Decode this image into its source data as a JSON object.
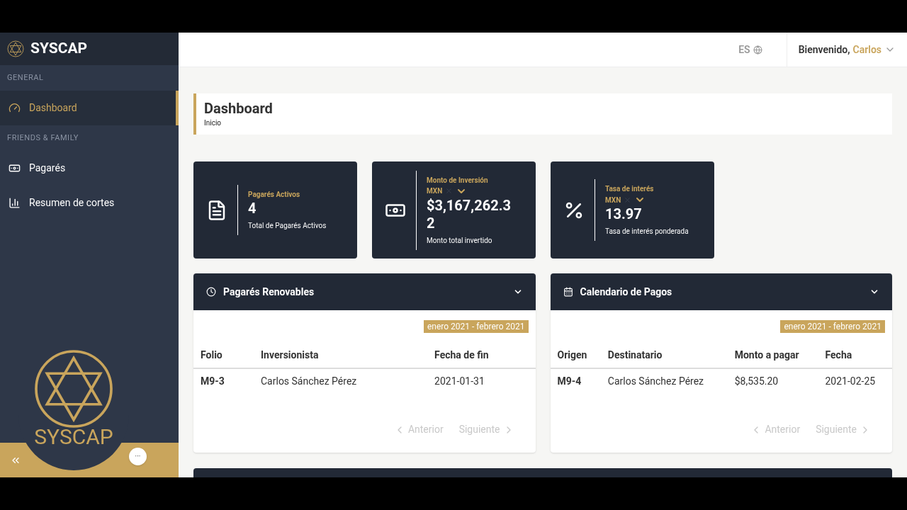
{
  "brand": {
    "name": "SYSCAP"
  },
  "sidebar": {
    "sections": [
      {
        "heading": "GENERAL",
        "items": [
          {
            "label": "Dashboard",
            "selected": true
          }
        ]
      },
      {
        "heading": "FRIENDS & FAMILY",
        "items": [
          {
            "label": "Pagarés",
            "selected": false
          },
          {
            "label": "Resumen de cortes",
            "selected": false
          }
        ]
      }
    ]
  },
  "overlay_logo": {
    "text": "SYSCAP"
  },
  "more_button": {
    "label": "···"
  },
  "header": {
    "language": "ES",
    "greeting": "Bienvenido,",
    "user": "Carlos"
  },
  "page_title": {
    "title": "Dashboard",
    "breadcrumb": "Inicio"
  },
  "stats": [
    {
      "label": "Pagarés Activos",
      "value": "4",
      "caption": "Total de Pagarés Activos"
    },
    {
      "label": "Monto de Inversión",
      "currency": "MXN",
      "value": "$3,167,262.32",
      "caption": "Monto total invertido"
    },
    {
      "label": "Tasa de interés",
      "currency": "MXN",
      "value": "13.97",
      "caption": "Tasa de interés ponderada"
    }
  ],
  "panels": [
    {
      "title": "Pagarés Renovables",
      "period": "enero 2021 - febrero 2021",
      "columns": [
        "Folio",
        "Inversionista",
        "Fecha de fin"
      ],
      "rows": [
        [
          "M9-3",
          "Carlos Sánchez Pérez",
          "2021-01-31"
        ]
      ],
      "prev": "Anterior",
      "next": "Siguiente"
    },
    {
      "title": "Calendario de Pagos",
      "period": "enero 2021 - febrero 2021",
      "columns": [
        "Origen",
        "Destinatario",
        "Monto a pagar",
        "Fecha"
      ],
      "rows": [
        [
          "M9-4",
          "Carlos Sánchez Pérez",
          "$8,535.20",
          "2021-02-25"
        ]
      ],
      "prev": "Anterior",
      "next": "Siguiente"
    }
  ]
}
